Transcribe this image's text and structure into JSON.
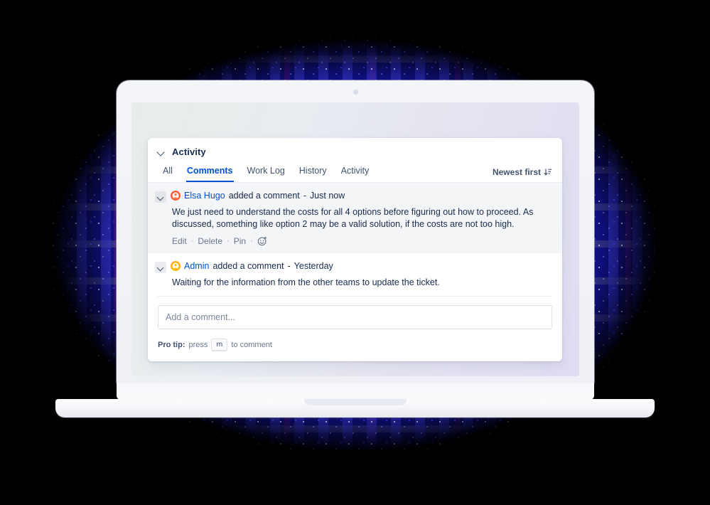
{
  "panel": {
    "title": "Activity",
    "collapse_icon": "chevron-down-icon"
  },
  "tabs": [
    {
      "label": "All",
      "active": false
    },
    {
      "label": "Comments",
      "active": true
    },
    {
      "label": "Work Log",
      "active": false
    },
    {
      "label": "History",
      "active": false
    },
    {
      "label": "Activity",
      "active": false
    }
  ],
  "sort": {
    "label": "Newest first",
    "icon": "sort-descending-icon"
  },
  "comments": [
    {
      "author": "Elsa Hugo",
      "action": "added a comment",
      "separator": "-",
      "time": "Just now",
      "body": "We just need to understand the costs for all 4 options before figuring out how to proceed. As discussed, something like option 2 may be a valid solution, if the costs are not too high.",
      "highlighted": true,
      "actions": [
        "Edit",
        "Delete",
        "Pin"
      ],
      "reaction_icon": "add-reaction-icon",
      "avatar_color": "#ff5630"
    },
    {
      "author": "Admin",
      "action": "added a comment",
      "separator": "-",
      "time": "Yesterday",
      "body": "Waiting for the information from the other teams to update the ticket.",
      "highlighted": false,
      "actions": [],
      "reaction_icon": "",
      "avatar_color": "#ffab00"
    }
  ],
  "composer": {
    "placeholder": "Add a comment...",
    "value": ""
  },
  "protip": {
    "label": "Pro tip:",
    "press": "press",
    "key": "m",
    "suffix": "to comment"
  },
  "colors": {
    "accent": "#0052cc",
    "text": "#172b4d",
    "muted": "#6b778c",
    "card_bg": "#ffffff",
    "row_highlight": "#f4f5f7",
    "border": "#dfe1e6"
  }
}
